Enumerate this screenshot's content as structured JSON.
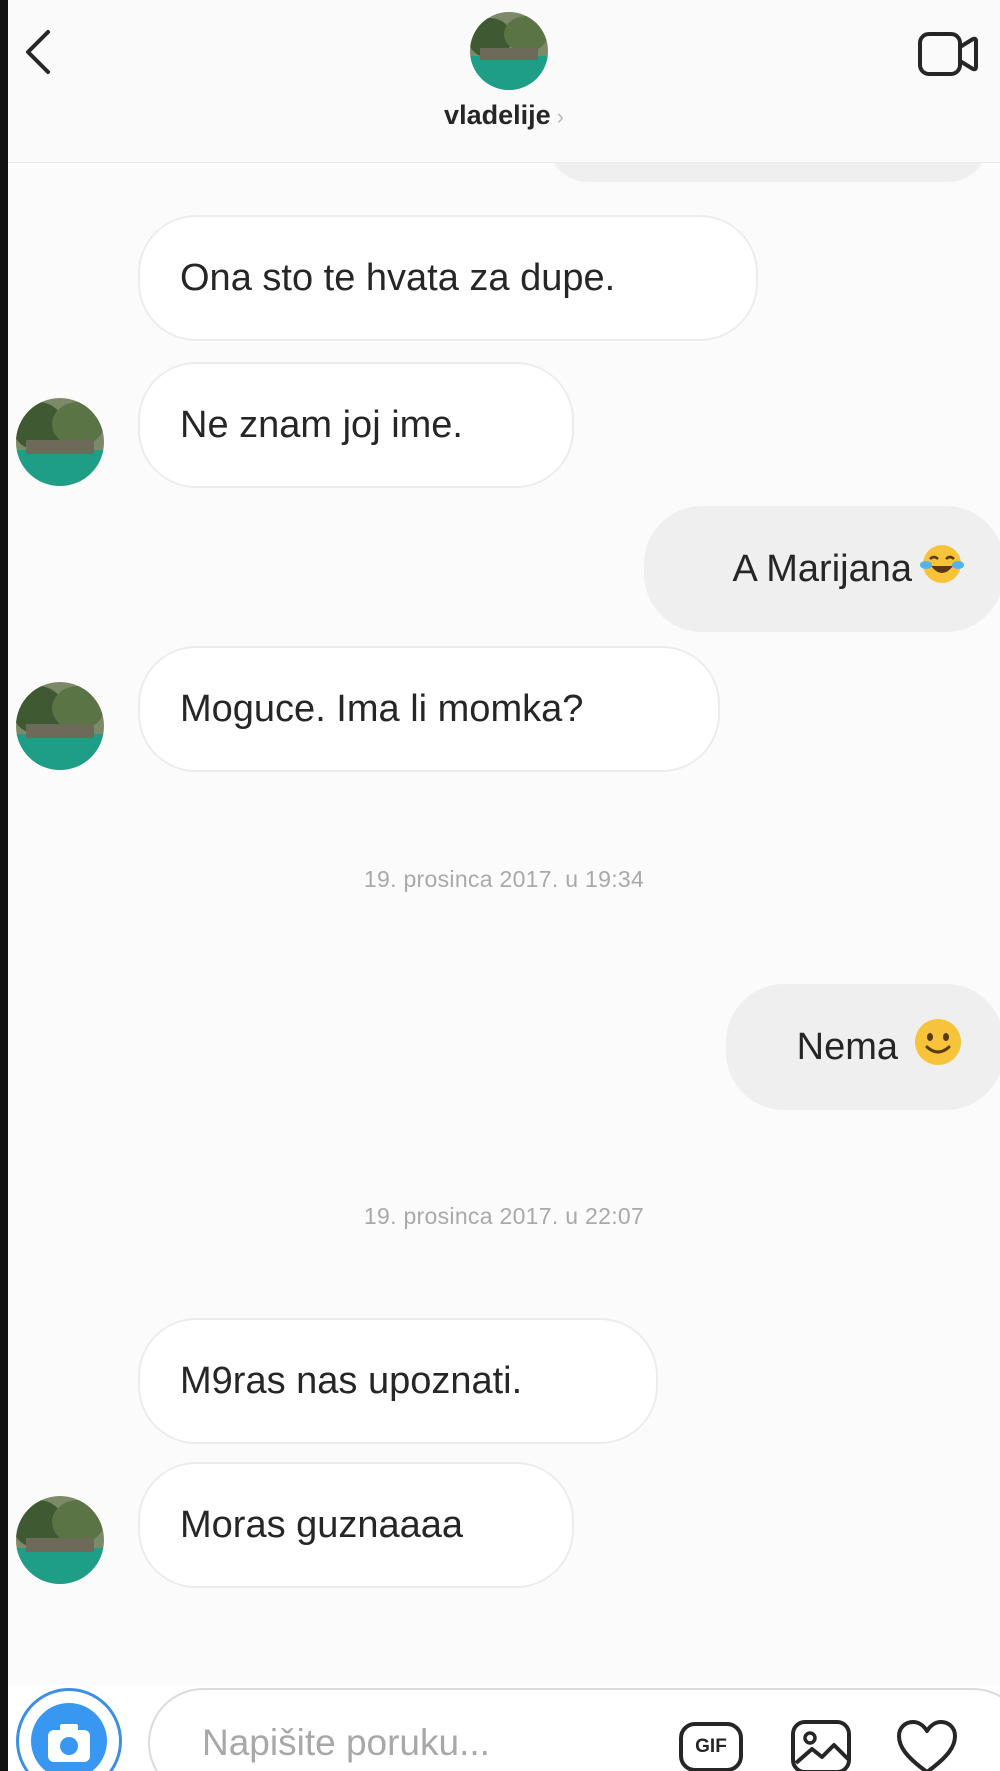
{
  "header": {
    "username": "vladelije",
    "chevron": "›",
    "back_icon": "back-chevron-icon",
    "video_icon": "video-call-icon"
  },
  "messages": [
    {
      "side": "in",
      "text": "Ona sto te hvata za dupe."
    },
    {
      "side": "in",
      "text": "Ne znam joj ime."
    },
    {
      "side": "out",
      "text": "A Marijana",
      "emoji": "tears-of-joy-emoji"
    },
    {
      "side": "in",
      "text": "Moguce. Ima li momka?"
    },
    {
      "side": "stamp",
      "text": "19. prosinca 2017. u 19:34"
    },
    {
      "side": "out",
      "text": "Nema",
      "emoji": "smiling-emoji"
    },
    {
      "side": "stamp",
      "text": "19. prosinca 2017. u 22:07"
    },
    {
      "side": "in",
      "text": "M9ras nas upoznati."
    },
    {
      "side": "in",
      "text": "Moras guznaaaa"
    }
  ],
  "composer": {
    "placeholder": "Napišite poruku...",
    "gif_label": "GIF",
    "icons": [
      "camera-icon",
      "gif-icon",
      "gallery-icon",
      "heart-icon"
    ]
  },
  "colors": {
    "accent": "#3897f0",
    "incoming_bubble_border": "#ececec",
    "outgoing_bubble": "#efefef",
    "timestamp": "#a9a9a9"
  }
}
